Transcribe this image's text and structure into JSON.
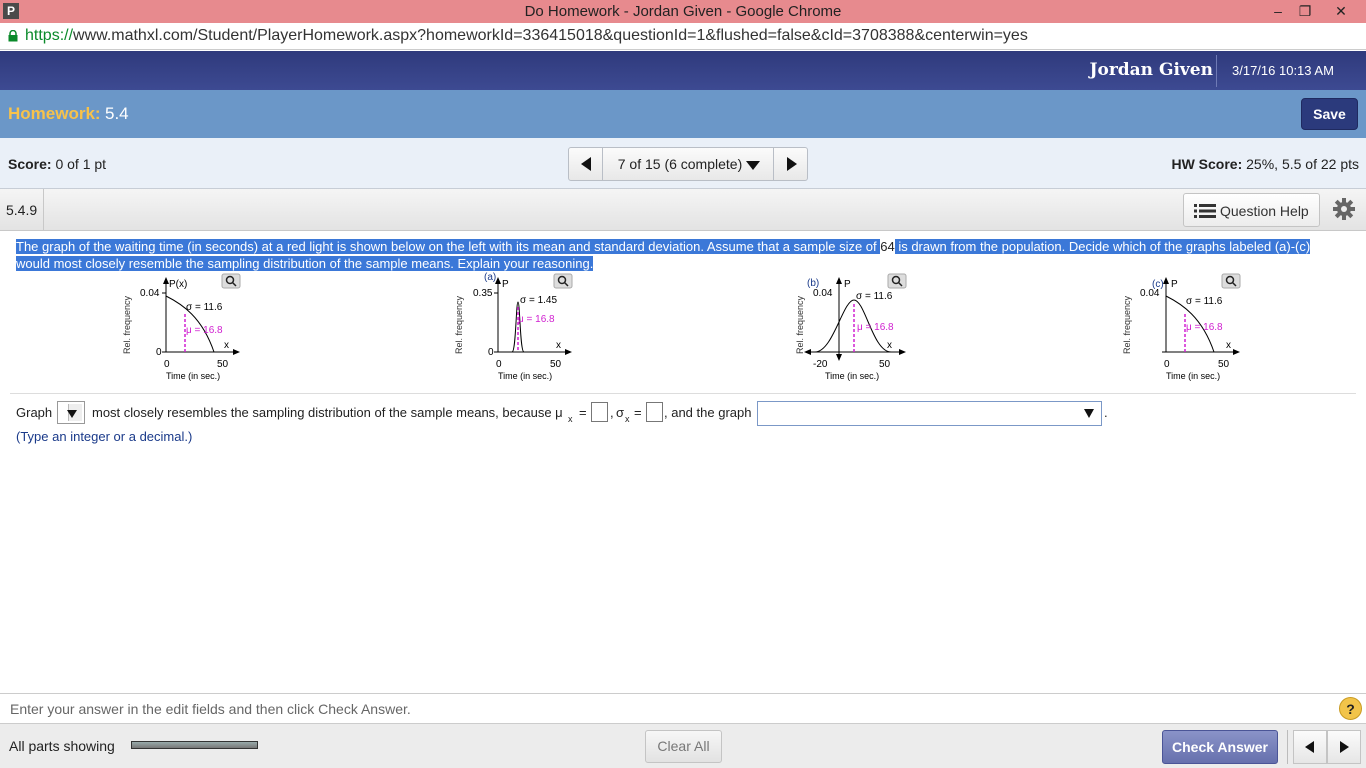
{
  "browser": {
    "window_title": "Do Homework - Jordan Given - Google Chrome",
    "app_icon_letter": "P",
    "url_scheme": "https://",
    "url_rest": "www.mathxl.com/Student/PlayerHomework.aspx?homeworkId=336415018&questionId=1&flushed=false&cId=3708388&centerwin=yes"
  },
  "header": {
    "user_name": "Jordan Given",
    "datetime": "3/17/16 10:13 AM"
  },
  "homework": {
    "label": "Homework:",
    "value": "5.4",
    "save_label": "Save"
  },
  "score": {
    "label": "Score:",
    "value": "0 of 1 pt",
    "nav_text": "7 of 15 (6 complete)",
    "hw_label": "HW Score:",
    "hw_value": "25%, 5.5 of 22 pts"
  },
  "question": {
    "id": "5.4.9",
    "help_label": "Question Help",
    "text_part1": "The graph of the waiting time (in seconds) at a red light is shown below on the left with its mean and standard deviation. Assume that a sample size of ",
    "sample_size": "64",
    "text_part2": " is drawn from the population. Decide which of the graphs labeled (a)-(c) would most closely resemble the sampling distribution of the sample means. Explain your reasoning."
  },
  "graphs": {
    "ylabel": "Rel. frequency",
    "xlabel": "Time (in sec.)",
    "x_sym": "x",
    "original": {
      "ymax": "0.04",
      "func": "P(x)",
      "sigma": "σ = 11.6",
      "mu": "μ = 16.8",
      "x0": "0",
      "x1": "50"
    },
    "a": {
      "label": "(a)",
      "ymax": "0.35",
      "func": "P",
      "sigma": "σ = 1.45",
      "mu": "μ = 16.8",
      "x0": "0",
      "x1": "50"
    },
    "b": {
      "label": "(b)",
      "ymax": "0.04",
      "func": "P",
      "sigma": "σ = 11.6",
      "mu": "μ = 16.8",
      "x0": "-20",
      "x1": "50"
    },
    "c": {
      "label": "(c)",
      "ymax": "0.04",
      "func": "P",
      "sigma": "σ = 11.6",
      "mu": "μ = 16.8",
      "x0": "0",
      "x1": "50"
    }
  },
  "answer": {
    "graph_word": "Graph",
    "mid_text": "most closely resembles the sampling distribution of the sample means, because μ",
    "eq": "=",
    "sigma_text": "σ",
    "and_text": ", and the graph",
    "comma": ",",
    "period": ".",
    "hint": "(Type an integer or a decimal.)"
  },
  "footer": {
    "instructions": "Enter your answer in the edit fields and then click Check Answer.",
    "help_q": "?",
    "parts": "All parts showing",
    "clear_all": "Clear All",
    "check_answer": "Check Answer"
  }
}
